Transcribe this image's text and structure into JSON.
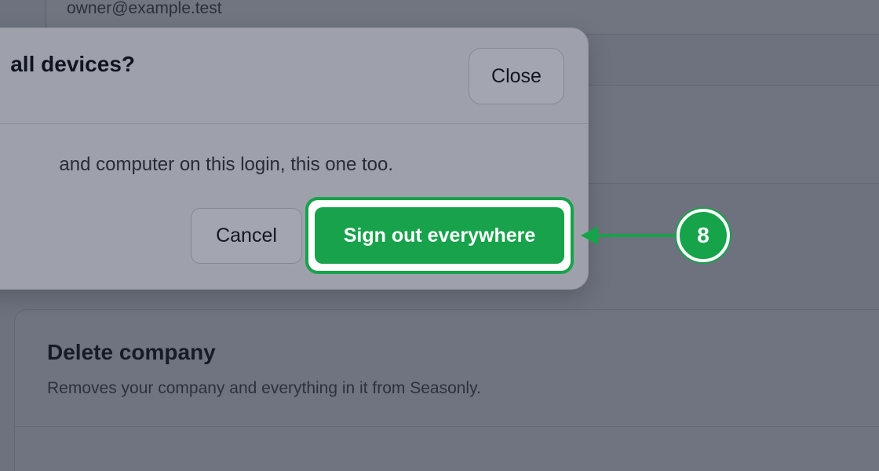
{
  "background": {
    "email_field_value": "owner@example.test",
    "delete_card": {
      "title": "Delete company",
      "description": "Removes your company and everything in it from Seasonly."
    }
  },
  "dialog": {
    "title": "all devices?",
    "close_label": "Close",
    "body": "and computer on this login, this one too.",
    "cancel_label": "Cancel",
    "confirm_label": "Sign out everywhere"
  },
  "annotation": {
    "step_number": "8"
  },
  "colors": {
    "accent": "#16a34a",
    "overlay_bg": "#6d727e",
    "dialog_bg": "#9ea1ab"
  }
}
